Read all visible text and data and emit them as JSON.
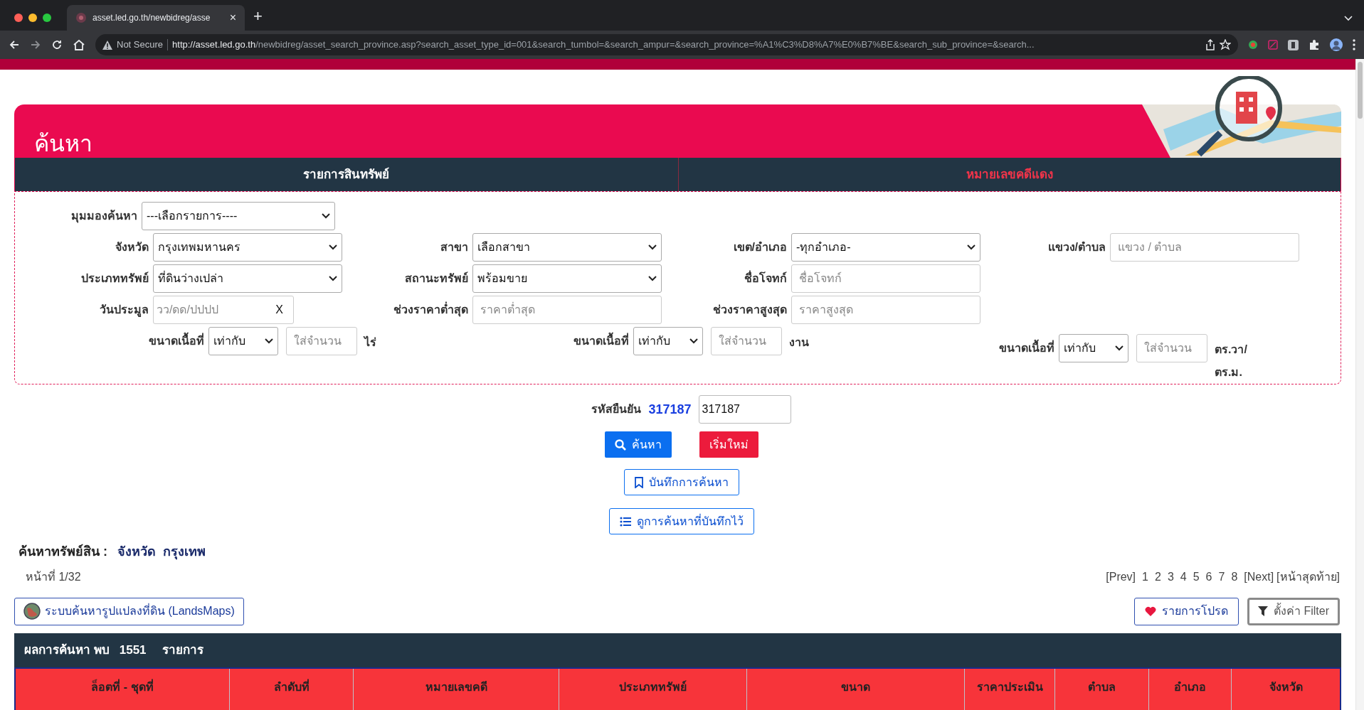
{
  "browser": {
    "tab_title": "asset.led.go.th/newbidreg/asse",
    "tab_close": "×",
    "new_tab": "+",
    "security": "Not Secure",
    "url_host": "http://asset.led.go.th",
    "url_rest": "/newbidreg/asset_search_province.asp?search_asset_type_id=001&search_tumbol=&search_ampur=&search_province=%A1%C3%D8%A7%E0%B7%BE&search_sub_province=&search..."
  },
  "header": {
    "title": "ค้นหา"
  },
  "tabs": [
    {
      "label": "รายการสินทรัพย์",
      "selected": true
    },
    {
      "label": "หมายเลขคดีแดง",
      "selected": false
    }
  ],
  "view": {
    "label": "มุมมองค้นหา",
    "value": "---เลือกรายการ----"
  },
  "fields": [
    {
      "kind": "select",
      "label": "จังหวัด",
      "value": "กรุงเทพมหานคร"
    },
    {
      "kind": "select",
      "label": "สาขา",
      "value": "เลือกสาขา"
    },
    {
      "kind": "select",
      "label": "เขต/อำเภอ",
      "value": "-ทุกอำเภอ-"
    },
    {
      "kind": "input",
      "label": "แขวง/ตำบล",
      "placeholder": "แขวง / ตำบล"
    },
    {
      "kind": "select",
      "label": "ประเภททรัพย์",
      "value": "ที่ดินว่างเปล่า"
    },
    {
      "kind": "select",
      "label": "สถานะทรัพย์",
      "value": "พร้อมขาย"
    },
    {
      "kind": "input",
      "label": "ชื่อโจทก์",
      "placeholder": "ชื่อโจทก์"
    },
    {
      "kind": "empty"
    },
    {
      "kind": "date",
      "label": "วันประมูล",
      "placeholder": "วว/ดด/ปปปป",
      "clear": "X"
    },
    {
      "kind": "input",
      "label": "ช่วงราคาต่ำสุด",
      "placeholder": "ราคาต่ำสุด"
    },
    {
      "kind": "input",
      "label": "ช่วงราคาสูงสุด",
      "placeholder": "ราคาสูงสุด"
    }
  ],
  "area_fields": [
    {
      "label": "ขนาดเนื้อที่",
      "operator": "เท่ากับ",
      "placeholder": "ใส่จำนวน",
      "unit": "ไร่"
    },
    {
      "label": "ขนาดเนื้อที่",
      "operator": "เท่ากับ",
      "placeholder": "ใส่จำนวน",
      "unit": "งาน"
    },
    {
      "label": "ขนาดเนื้อที่",
      "operator": "เท่ากับ",
      "placeholder": "ใส่จำนวน",
      "unit": "ตร.วา/ ตร.ม."
    }
  ],
  "captcha": {
    "label": "รหัสยืนยัน",
    "code": "317187",
    "value": "317187"
  },
  "buttons": {
    "search": "ค้นหา",
    "reset": "เริ่มใหม่",
    "save": "บันทึกการค้นหา",
    "view_saved": "ดูการค้นหาที่บันทึกไว้"
  },
  "summary": {
    "label": "ค้นหาทรัพย์สิน :",
    "field": "จังหวัด",
    "value": "กรุงเทพ"
  },
  "pagination": {
    "page": "หน้าที่ 1/32",
    "prev": "[Prev]",
    "pages": [
      "1",
      "2",
      "3",
      "4",
      "5",
      "6",
      "7",
      "8"
    ],
    "next": "[Next]",
    "last": "[หน้าสุดท้าย]"
  },
  "tools": {
    "landsmaps": "ระบบค้นหารูปแปลงที่ดิน (LandsMaps)",
    "favorites": "รายการโปรด",
    "filter": "ตั้งค่า Filter"
  },
  "results": {
    "label": "ผลการค้นหา พบ",
    "count": "1551",
    "unit": "รายการ"
  },
  "table": {
    "columns": [
      "ล็อตที่ - ชุดที่",
      "ลำดับที่",
      "หมายเลขคดี",
      "ประเภททรัพย์",
      "ขนาด",
      "ราคาประเมิน",
      "ตำบล",
      "อำเภอ",
      "จังหวัด"
    ]
  }
}
